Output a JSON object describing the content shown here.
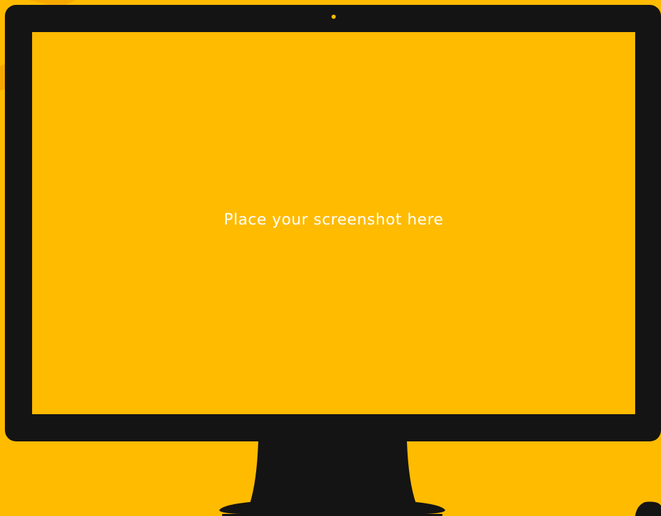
{
  "screen": {
    "placeholder_text": "Place your screenshot here"
  },
  "colors": {
    "background": "#FFBB00",
    "bezel": "#141414",
    "screen": "#FFBB00",
    "text": "#FFFFFF",
    "decoration": "#F29A00"
  },
  "icons": {
    "camera": "camera-dot-icon"
  }
}
